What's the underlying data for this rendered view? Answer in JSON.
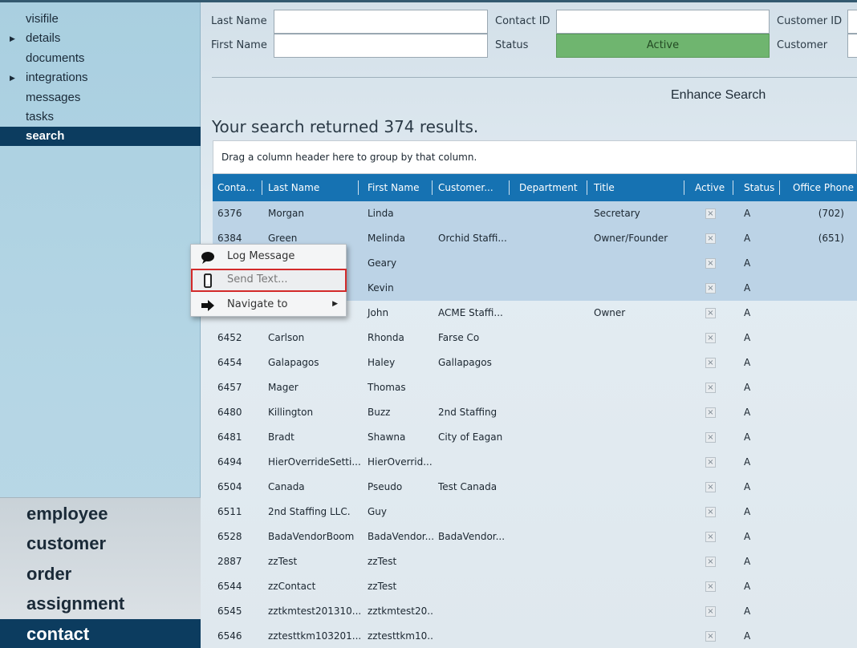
{
  "sidebar": {
    "items": [
      {
        "label": "visifile",
        "arrow": false,
        "active": false
      },
      {
        "label": "details",
        "arrow": true,
        "active": false
      },
      {
        "label": "documents",
        "arrow": false,
        "active": false
      },
      {
        "label": "integrations",
        "arrow": true,
        "active": false
      },
      {
        "label": "messages",
        "arrow": false,
        "active": false
      },
      {
        "label": "tasks",
        "arrow": false,
        "active": false
      },
      {
        "label": "search",
        "arrow": false,
        "active": true
      }
    ],
    "modules": [
      {
        "label": "employee",
        "active": false
      },
      {
        "label": "customer",
        "active": false
      },
      {
        "label": "order",
        "active": false
      },
      {
        "label": "assignment",
        "active": false
      },
      {
        "label": "contact",
        "active": true
      }
    ]
  },
  "search_form": {
    "last_name_label": "Last Name",
    "last_name_value": "",
    "first_name_label": "First Name",
    "first_name_value": "",
    "contact_id_label": "Contact ID",
    "contact_id_value": "",
    "status_label": "Status",
    "status_value": "Active",
    "customer_id_label": "Customer ID",
    "customer_id_value": "",
    "customer_label": "Customer",
    "customer_value": ""
  },
  "enhance_search_label": "Enhance Search",
  "results_heading": "Your search returned 374 results.",
  "group_bar_text": "Drag a column header here to group by that column.",
  "grid": {
    "columns": [
      "Conta...",
      "Last Name",
      "First Name",
      "Customer...",
      "Department",
      "Title",
      "Active",
      "Status",
      "Office Phone"
    ],
    "rows": [
      {
        "id": "6376",
        "last": "Morgan",
        "first": "Linda",
        "customer": "",
        "dept": "",
        "title": "Secretary",
        "status": "A",
        "phone": "(702)"
      },
      {
        "id": "6384",
        "last": "Green",
        "first": "Melinda",
        "customer": "Orchid Staffi...",
        "dept": "",
        "title": "Owner/Founder",
        "status": "A",
        "phone": "(651)"
      },
      {
        "id": "",
        "last": "",
        "first": "Geary",
        "customer": "",
        "dept": "",
        "title": "",
        "status": "A",
        "phone": ""
      },
      {
        "id": "",
        "last": "",
        "first": "Kevin",
        "customer": "",
        "dept": "",
        "title": "",
        "status": "A",
        "phone": ""
      },
      {
        "id": "",
        "last": "",
        "first": "John",
        "customer": "ACME Staffi...",
        "dept": "",
        "title": "Owner",
        "status": "A",
        "phone": ""
      },
      {
        "id": "6452",
        "last": "Carlson",
        "first": "Rhonda",
        "customer": "Farse Co",
        "dept": "",
        "title": "",
        "status": "A",
        "phone": ""
      },
      {
        "id": "6454",
        "last": "Galapagos",
        "first": "Haley",
        "customer": "Gallapagos",
        "dept": "",
        "title": "",
        "status": "A",
        "phone": ""
      },
      {
        "id": "6457",
        "last": "Mager",
        "first": "Thomas",
        "customer": "",
        "dept": "",
        "title": "",
        "status": "A",
        "phone": ""
      },
      {
        "id": "6480",
        "last": "Killington",
        "first": "Buzz",
        "customer": "2nd Staffing",
        "dept": "",
        "title": "",
        "status": "A",
        "phone": ""
      },
      {
        "id": "6481",
        "last": "Bradt",
        "first": "Shawna",
        "customer": "City of Eagan",
        "dept": "",
        "title": "",
        "status": "A",
        "phone": ""
      },
      {
        "id": "6494",
        "last": "HierOverrideSetti...",
        "first": "HierOverrid...",
        "customer": "",
        "dept": "",
        "title": "",
        "status": "A",
        "phone": ""
      },
      {
        "id": "6504",
        "last": "Canada",
        "first": "Pseudo",
        "customer": "Test Canada",
        "dept": "",
        "title": "",
        "status": "A",
        "phone": ""
      },
      {
        "id": "6511",
        "last": "2nd Staffing LLC.",
        "first": "Guy",
        "customer": "",
        "dept": "",
        "title": "",
        "status": "A",
        "phone": ""
      },
      {
        "id": "6528",
        "last": "BadaVendorBoom",
        "first": "BadaVendor...",
        "customer": "BadaVendor...",
        "dept": "",
        "title": "",
        "status": "A",
        "phone": ""
      },
      {
        "id": "2887",
        "last": "zzTest",
        "first": "zzTest",
        "customer": "",
        "dept": "",
        "title": "",
        "status": "A",
        "phone": ""
      },
      {
        "id": "6544",
        "last": "zzContact",
        "first": "zzTest",
        "customer": "",
        "dept": "",
        "title": "",
        "status": "A",
        "phone": ""
      },
      {
        "id": "6545",
        "last": "zztkmtest201310...",
        "first": "zztkmtest20...",
        "customer": "",
        "dept": "",
        "title": "",
        "status": "A",
        "phone": ""
      },
      {
        "id": "6546",
        "last": "zztesttkm103201...",
        "first": "zztesttkm10...",
        "customer": "",
        "dept": "",
        "title": "",
        "status": "A",
        "phone": ""
      }
    ]
  },
  "context_menu": {
    "items": [
      {
        "label": "Log Message",
        "icon": "speech-bubble-icon"
      },
      {
        "label": "Send Text...",
        "icon": "mobile-phone-icon"
      },
      {
        "label": "Navigate to",
        "icon": "arrow-right-icon"
      }
    ]
  },
  "colors": {
    "header_blue": "#1672b2",
    "active_nav": "#0c3c5f",
    "status_green": "#6fb56f",
    "highlight_red": "#d32a2a"
  }
}
